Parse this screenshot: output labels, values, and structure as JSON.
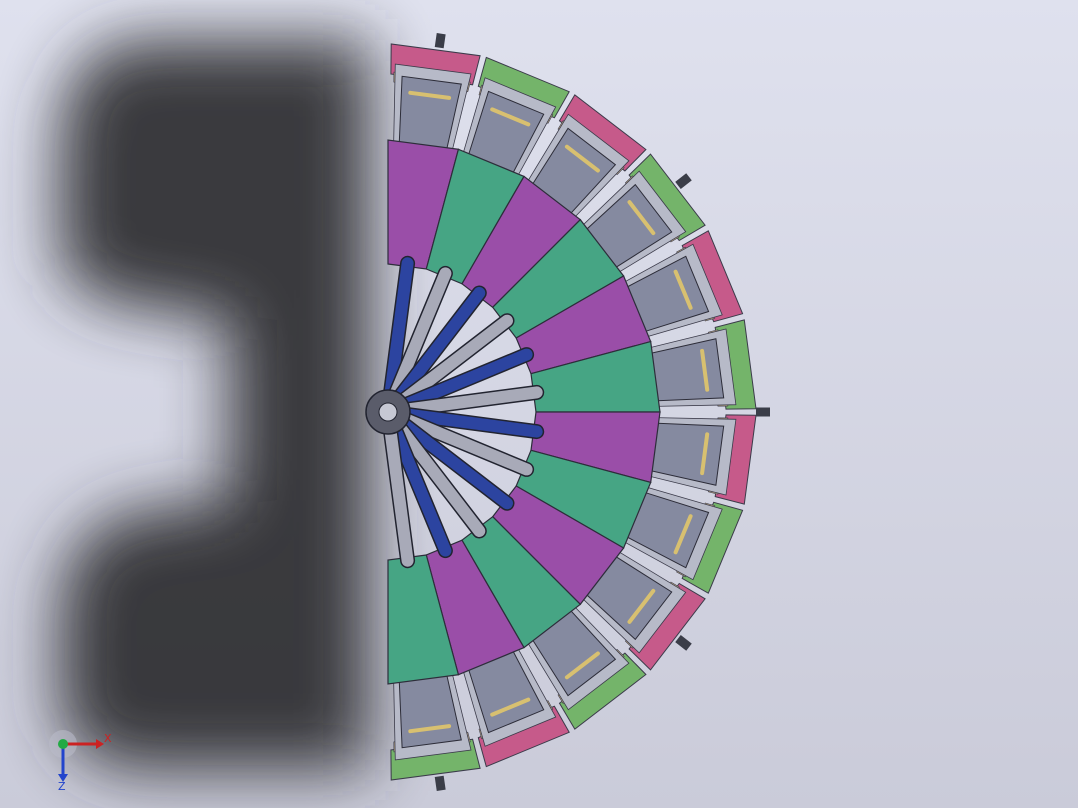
{
  "viewport": {
    "background_top": "#dfe1ee",
    "background_bottom": "#cacbd9",
    "shadow_color": "#303034"
  },
  "model": {
    "segment_count": 12,
    "colors": {
      "magenta": "#9a4ea8",
      "green": "#46a584",
      "strut_blue": "#2c44a0",
      "strut_grey": "#a8aab8",
      "rim_pink": "#c65a8a",
      "rim_green": "#74b46a",
      "module_face": "#858aa0",
      "module_side": "#b7bac8",
      "tan": "#c9b48c",
      "handle": "#d8c070",
      "connector": "#3a3d48"
    }
  },
  "triad": {
    "x_label": "X",
    "z_label": "Z",
    "x_color": "#cc2222",
    "z_color": "#2244cc",
    "origin_color": "#22aa44"
  }
}
